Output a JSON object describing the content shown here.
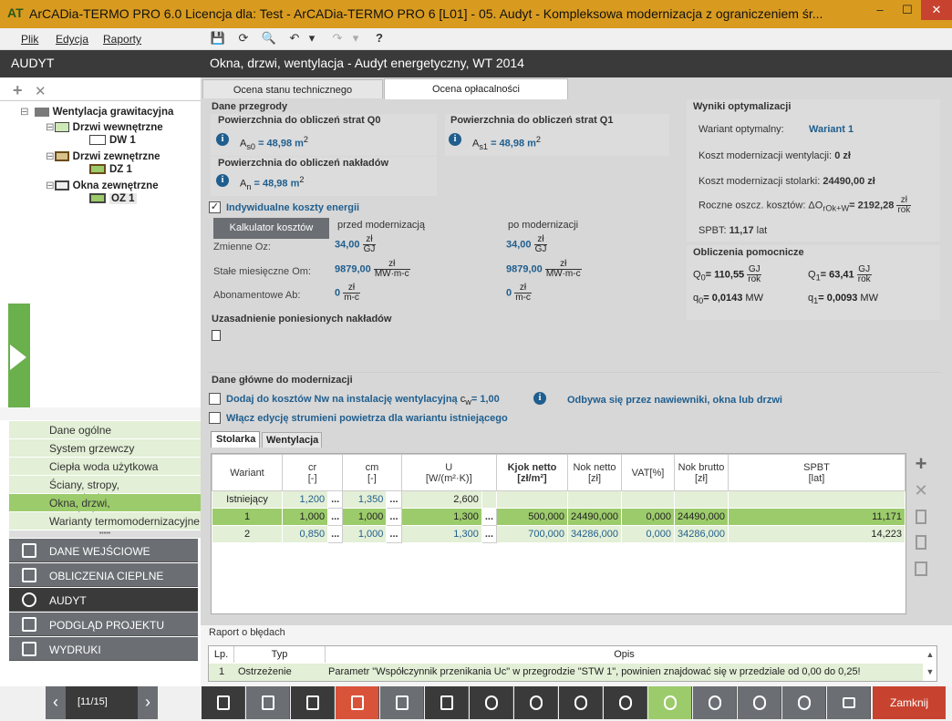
{
  "window": {
    "title": "ArCADia-TERMO PRO 6.0 Licencja dla: Test - ArCADia-TERMO PRO 6 [L01] - 05. Audyt - Kompleksowa modernizacja z ograniczeniem śr...",
    "minimize": "–",
    "maximize": "☐",
    "close": "✕"
  },
  "menu": {
    "file": "Plik",
    "edit": "Edycja",
    "reports": "Raporty"
  },
  "toolbar": {
    "save": "💾",
    "refresh": "⟳",
    "preview": "🔍",
    "undo": "↶",
    "undo_drop": "▾",
    "redo": "↷",
    "redo_drop": "▾",
    "help": "?"
  },
  "left": {
    "header": "AUDYT",
    "add": "+",
    "remove": "✕",
    "tree": [
      {
        "label": "Wentylacja grawitacyjna",
        "bold": true
      },
      {
        "label": "Drzwi wewnętrzne",
        "bold": true
      },
      {
        "label": "DW 1",
        "bold": true
      },
      {
        "label": "Drzwi zewnętrzne",
        "bold": true
      },
      {
        "label": "DZ 1",
        "bold": true
      },
      {
        "label": "Okna zewnętrzne",
        "bold": true
      },
      {
        "label": "OZ 1",
        "bold": true
      }
    ],
    "links": [
      "Dane ogólne",
      "System grzewczy",
      "Ciepła woda użytkowa",
      "Ściany, stropy, stropodachy",
      "Okna, drzwi, wentylacja",
      "Warianty termomodernizacyjne"
    ],
    "sections": [
      "DANE WEJŚCIOWE",
      "OBLICZENIA CIEPLNE",
      "AUDYT",
      "PODGLĄD PROJEKTU",
      "WYDRUKI"
    ],
    "page_indicator": "[11/15]",
    "prev": "‹",
    "next": "›",
    "dots": "•••••"
  },
  "main": {
    "title": "Okna, drzwi, wentylacja - Audyt energetyczny, WT 2014",
    "tabs": [
      "Ocena stanu technicznego",
      "Ocena opłacalności"
    ],
    "dane": {
      "header": "Dane przegrody",
      "q0_title": "Powierzchnia do obliczeń strat Q0",
      "q0_sym": "A",
      "q0_sub": "s0",
      "q0_val": "= 48,98 m",
      "q1_title": "Powierzchnia do obliczeń strat Q1",
      "q1_sym": "A",
      "q1_sub": "s1",
      "q1_val": "= 48,98 m",
      "n_title": "Powierzchnia do obliczeń nakładów",
      "n_sym": "A",
      "n_sub": "n",
      "n_val": "= 48,98 m",
      "sup": "2",
      "info": "i"
    },
    "koszty": {
      "checkbox_label": "Indywidualne koszty energii",
      "calc_button": "Kalkulator kosztów",
      "before": "przed modernizacją",
      "after": "po modernizacji",
      "rows": [
        {
          "label": "Zmienne Oz:",
          "before": "34,00",
          "after": "34,00",
          "num": "zł",
          "den": "GJ"
        },
        {
          "label": "Stałe miesięczne Om:",
          "before": "9879,00",
          "after": "9879,00",
          "num": "zł",
          "den": "MW·m-c"
        },
        {
          "label": "Abonamentowe Ab:",
          "before": "0",
          "after": "0",
          "num": "zł",
          "den": "m-c"
        }
      ]
    },
    "uzasadnienie": "Uzasadnienie poniesionych nakładów",
    "wyniki": {
      "header": "Wyniki optymalizacji",
      "wariant_label": "Wariant optymalny:",
      "wariant_value": "Wariant 1",
      "koszt_went": "Koszt modernizacji wentylacji:",
      "koszt_went_val": "0 zł",
      "koszt_stol": "Koszt modernizacji stolarki:",
      "koszt_stol_val": "24490,00 zł",
      "roczne": "Roczne oszcz. kosztów: ΔO",
      "roczne_sub": "rOk+W",
      "roczne_val": "= 2192,28",
      "roczne_num": "zł",
      "roczne_den": "rok",
      "spbt": "SPBT:",
      "spbt_val": "11,17",
      "spbt_unit": "lat"
    },
    "pomocnicze": {
      "header": "Obliczenia pomocnicze",
      "Q": "Q",
      "q": "q",
      "q0_sub": "0",
      "q0_val": "= 110,55",
      "q1_sub": "1",
      "q1_val": "= 63,41",
      "num": "GJ",
      "den": "rok",
      "qq0_val": "= 0,0143",
      "qq1_val": "= 0,0093",
      "mw": "MW"
    },
    "glowne": {
      "header": "Dane główne do modernizacji",
      "chk1": "Dodaj do kosztów Nw na instalację wentylacyjną",
      "cw_sym": "c",
      "cw_sub": "w",
      "cw_val": "= 1,00",
      "note": "Odbywa się przez nawiewniki, okna lub drzwi",
      "chk2": "Włącz edycję strumieni powietrza dla wariantu istniejącego",
      "subtabs": [
        "Stolarka",
        "Wentylacja"
      ]
    },
    "table": {
      "headers": [
        {
          "l1": "Wariant",
          "l2": ""
        },
        {
          "l1": "cr",
          "l2": "[-]"
        },
        {
          "l1": "cm",
          "l2": "[-]"
        },
        {
          "l1": "U",
          "l2": "[W/(m²·K)]"
        },
        {
          "l1": "Kjok netto",
          "l2": "[zł/m²]"
        },
        {
          "l1": "Nok netto",
          "l2": "[zł]"
        },
        {
          "l1": "VAT[%]",
          "l2": ""
        },
        {
          "l1": "Nok brutto",
          "l2": "[zł]"
        },
        {
          "l1": "SPBT",
          "l2": "[lat]"
        }
      ],
      "dots": "...",
      "rows": [
        {
          "wariant": "Istniejący",
          "cr": "1,200",
          "cm": "1,350",
          "u": "2,600",
          "kjok": "",
          "nok": "",
          "vat": "",
          "brutto": "",
          "spbt": ""
        },
        {
          "wariant": "1",
          "cr": "1,000",
          "cm": "1,000",
          "u": "1,300",
          "kjok": "500,000",
          "nok": "24490,000",
          "vat": "0,000",
          "brutto": "24490,000",
          "spbt": "11,171"
        },
        {
          "wariant": "2",
          "cr": "0,850",
          "cm": "1,000",
          "u": "1,300",
          "kjok": "700,000",
          "nok": "34286,000",
          "vat": "0,000",
          "brutto": "34286,000",
          "spbt": "14,223"
        }
      ]
    },
    "side_icons": {
      "add": "+",
      "remove": "✕"
    },
    "raport": {
      "header": "Raport o błędach",
      "col_lp": "Lp.",
      "col_typ": "Typ",
      "col_opis": "Opis",
      "rows": [
        {
          "lp": "1",
          "typ": "Ostrzeżenie",
          "opis": "Parametr \"Współczynnik przenikania Uc\" w przegrodzie \"STW 1\", powinien znajdować się w przedziale od 0,00 do 0,25!"
        }
      ]
    }
  },
  "bottom": {
    "close": "Zamknij"
  },
  "colors": {
    "accent_green": "#9ccb6b",
    "light_green": "#e3efd6",
    "dark": "#3a3a3a",
    "title_orange": "#d99b1f",
    "close_red": "#c7432f",
    "blue_text": "#1f5e8e"
  }
}
